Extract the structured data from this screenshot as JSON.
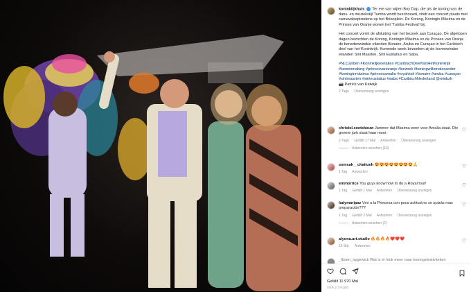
{
  "post": {
    "username": "koninklijkhuis",
    "caption_1": "Ter ere van wijlen Boy Dap, die als de koning van de dans- en muziekstijl Tumba wordt beschouwd, vindt een concert plaats met carnavalsoptredens op het Brionplein. De Koning, Koningin Máxima en de Prinses van Oranje wonen het 'Tumba Festival' bij.",
    "caption_2": "Het concert vormt de afsluiting van het bezoek aan Curaçao. De afgelopen dagen bezochten de Koning, Koningin Máxima en de Prinses van Oranje de benedenwindse eilanden Bonaire, Aruba en Curaçao in het Caribisch deel van het Koninkrijk. Komende week bezoeken zij de bovenwindse eilanden Sint Maarten, Sint Eustatius en Saba.",
    "hashtags": "#NLCariben #Koninklijkerelaties #CaribischDeelVanHetKoninkrijk #kennismaking #prinsesvanoranje #bezoek #koningwillemalexander #koninginmáxima #prinsesamalia #royalvisit #bonaire #aruba #curaçao #sintmaarten #sinteustatius #saba #CaribischNederland @minbzk",
    "credit": "📷 Patrick van Katwijk",
    "meta_time": "2 Tage",
    "meta_translate": "Übersetzung anzeigen"
  },
  "comments": [
    {
      "user": "christel.soetekouw",
      "text": "Jammer dat Maxima weer voor Amalia staat. Die groene jurk staat haar mooi.",
      "time": "2 Tage",
      "likes": "Gefällt 17 Mal",
      "reply": "Antworten",
      "translate": "Übersetzung anzeigen",
      "replies": "Antworten ansehen (10)"
    },
    {
      "user": "somsak__chaitueh",
      "text": "😍😍😍😍😍😍😍😍🙏",
      "time": "1 Tag",
      "reply": "Antworten"
    },
    {
      "user": "emmorrice",
      "text": "You guys know how to do a Royal tour!",
      "time": "1 Tag",
      "likes": "Gefällt 1 Mal",
      "reply": "Antworten",
      "translate": "Übersetzung anzeigen"
    },
    {
      "user": "ladymaripaz",
      "text": "Veo a la Princesa con poca actitud,no se quizás mas preparación???",
      "time": "1 Tag",
      "likes": "Gefällt 2 Mal",
      "reply": "Antworten",
      "translate": "Übersetzung anzeigen",
      "replies": "Antworten ansehen (2)"
    },
    {
      "user": "alyona.art.studio",
      "text": "🔥🔥🔥🔥❤️❤️❤️",
      "time": "19 Std.",
      "reply": "Antworten"
    }
  ],
  "partial_comment": "_fboen_opgewick Wat is er leuk meer naar koningsfestiviteiten",
  "footer": {
    "likes": "Gefällt 11.970 Mal",
    "date": "VOR 2 TAGEN"
  },
  "icons": [
    "heart-icon",
    "comment-icon",
    "share-icon",
    "bookmark-icon"
  ],
  "colors": {
    "link": "#00376b",
    "muted": "#8e8e8e",
    "verified": "#3897f0"
  }
}
